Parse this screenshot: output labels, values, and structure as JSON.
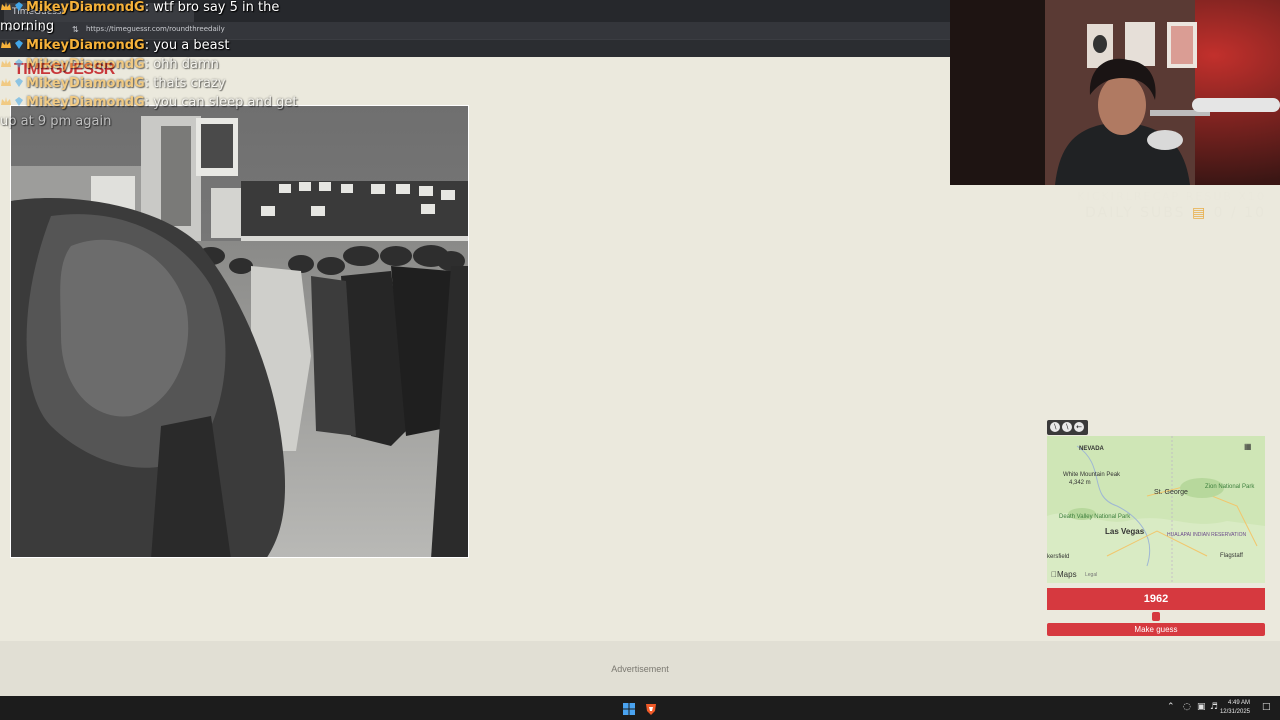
{
  "browser": {
    "tab_title": "TimeGuessr",
    "url": "https://timeguessr.com/roundthreedaily"
  },
  "site": {
    "logo_text": "TIMEGUESSR"
  },
  "chat": {
    "messages": [
      {
        "user": "MikeyDiamondG",
        "text": ": wtf bro say 5 in the",
        "cont": "morning"
      },
      {
        "user": "MikeyDiamondG",
        "text": ": you a beast"
      },
      {
        "user": "MikeyDiamondG",
        "text": ": ohh damn"
      },
      {
        "user": "MikeyDiamondG",
        "text": ": thats crazy"
      },
      {
        "user": "MikeyDiamondG",
        "text": ": you can sleep and get",
        "cont": "up at 9 pm again"
      }
    ]
  },
  "stream_overlay": {
    "recap_line": "KICKIRLRECAP RESUB X10",
    "subs_label": "DAILY SUBS",
    "subs_icon": "gift-icon",
    "subs_count": "0 / 10"
  },
  "map": {
    "labels": {
      "nevada": "NEVADA",
      "white_mountain": "White Mountain Peak",
      "white_mountain_elev": "4,342 m",
      "st_george": "St. George",
      "zion": "Zion National Park",
      "death_valley": "Death Valley National Park",
      "las_vegas": "Las Vegas",
      "hualapai": "HUALAPAI INDIAN RESERVATION",
      "bakersfield": "kersfield",
      "flagstaff": "Flagstaff",
      "attribution": "Maps",
      "legal": "Legal"
    }
  },
  "guess": {
    "year": "1962",
    "slider_fraction": 0.5,
    "button_label": "Make guess"
  },
  "ad": {
    "label": "Advertisement"
  },
  "taskbar": {
    "time": "4:49 AM",
    "date": "12/31/2025"
  },
  "colors": {
    "accent": "#d6393f",
    "background": "#ebe9dd",
    "chat_user": "#f6b23a"
  }
}
